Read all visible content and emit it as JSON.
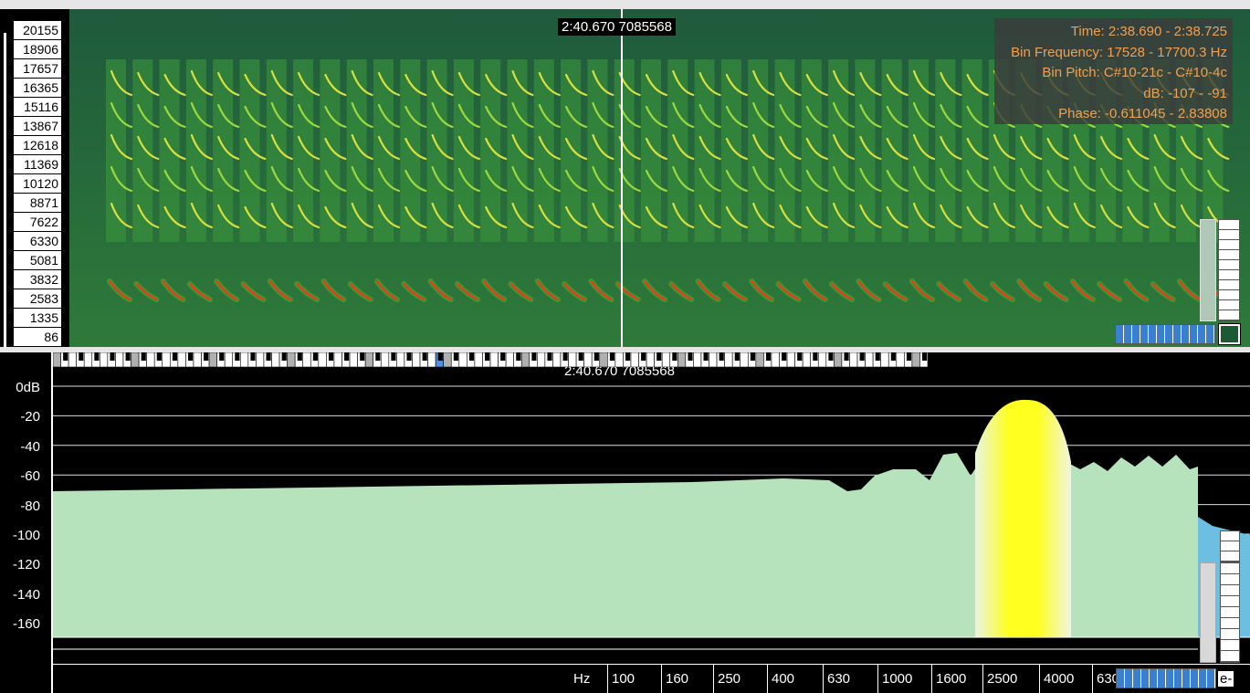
{
  "spectrogram": {
    "frequency_labels": [
      "20155",
      "18906",
      "17657",
      "16365",
      "15116",
      "13867",
      "12618",
      "11369",
      "10120",
      "8871",
      "7622",
      "6330",
      "5081",
      "3832",
      "2583",
      "1335",
      "86"
    ],
    "position_readout": "2:40.670   7085568",
    "info": {
      "time": "Time: 2:38.690 - 2:38.725",
      "bin_frequency": "Bin Frequency: 17528 - 17700.3 Hz",
      "bin_pitch": "Bin Pitch: C#10-21c - C#10-4c",
      "db": "dB: -107 - -91",
      "phase": "Phase: -0.611045 - 2.83808"
    },
    "colors": {
      "background": "#1f5a3c",
      "harmonic": "#d8e040",
      "fundamental": "#e04020"
    }
  },
  "analyser": {
    "position_readout": "2:40.670   7085568",
    "db_labels": [
      "0dB",
      "-20",
      "-40",
      "-60",
      "-80",
      "-100",
      "-120",
      "-140",
      "-160"
    ],
    "hz_axis_labels": [
      "Hz",
      "100",
      "160",
      "250",
      "400",
      "630",
      "1000",
      "1600",
      "2500",
      "4000",
      "630"
    ],
    "hz_axis_cut_label": "e-",
    "colors": {
      "fill": "#b6e2bc",
      "peak": "#ffff20",
      "highlight_key": "#4f8fe8"
    }
  }
}
